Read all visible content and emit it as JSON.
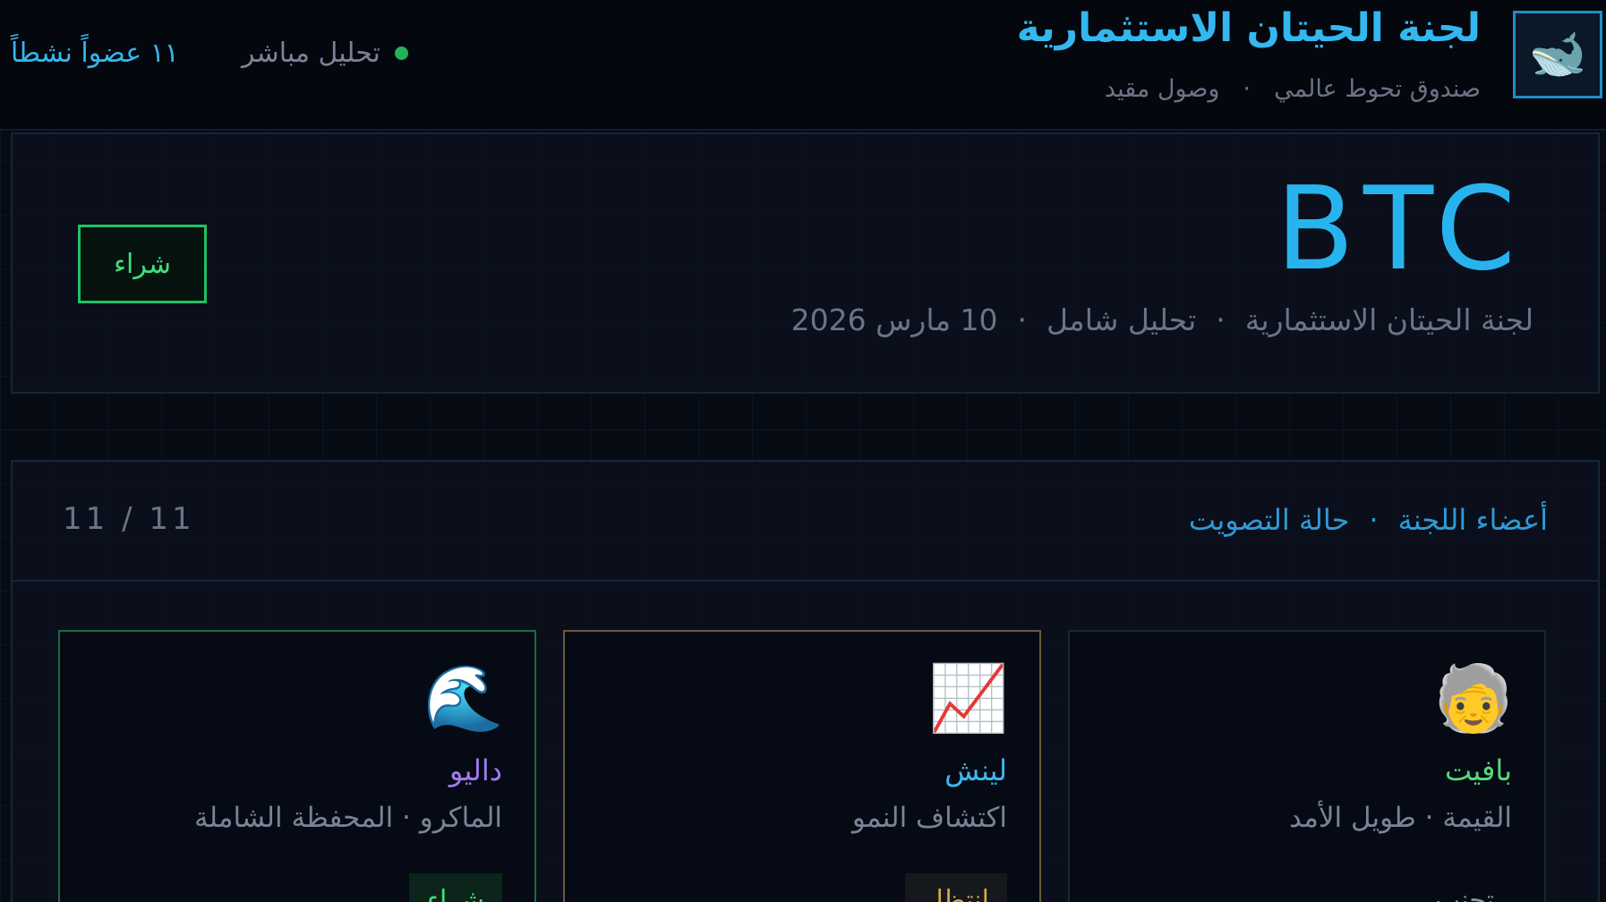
{
  "header": {
    "logo_emoji": "🐋",
    "title": "لجنة الحيتان الاستثمارية",
    "subtitle_left": "صندوق تحوط عالمي",
    "subtitle_sep": "·",
    "subtitle_right": "وصول مقيد",
    "live_label": "تحليل مباشر",
    "live_color": "#22b35a",
    "members_active": "١١ عضواً نشطاً"
  },
  "hero": {
    "ticker": "BTC",
    "meta_committee": "لجنة الحيتان الاستثمارية",
    "meta_sep": "·",
    "meta_type": "تحليل شامل",
    "meta_date": "10 مارس 2026",
    "decision_label": "شراء",
    "decision_color": "#3ee07a"
  },
  "panel": {
    "title_members": "أعضاء اللجنة",
    "title_sep": "·",
    "title_status": "حالة التصويت",
    "vote_count": "11 / 11"
  },
  "cards": [
    {
      "emoji": "🧓",
      "name": "بافيت",
      "role": "القيمة · طويل الأمد",
      "badge": "تجنب",
      "name_color": "#55d97a"
    },
    {
      "emoji": "📈",
      "name": "لينش",
      "role": "اكتشاف النمو",
      "badge": "انتظار",
      "name_color": "#3fb6ee"
    },
    {
      "emoji": "🌊",
      "name": "داليو",
      "role": "الماكرو · المحفظة الشاملة",
      "badge": "شراء",
      "name_color": "#a07af0"
    }
  ]
}
